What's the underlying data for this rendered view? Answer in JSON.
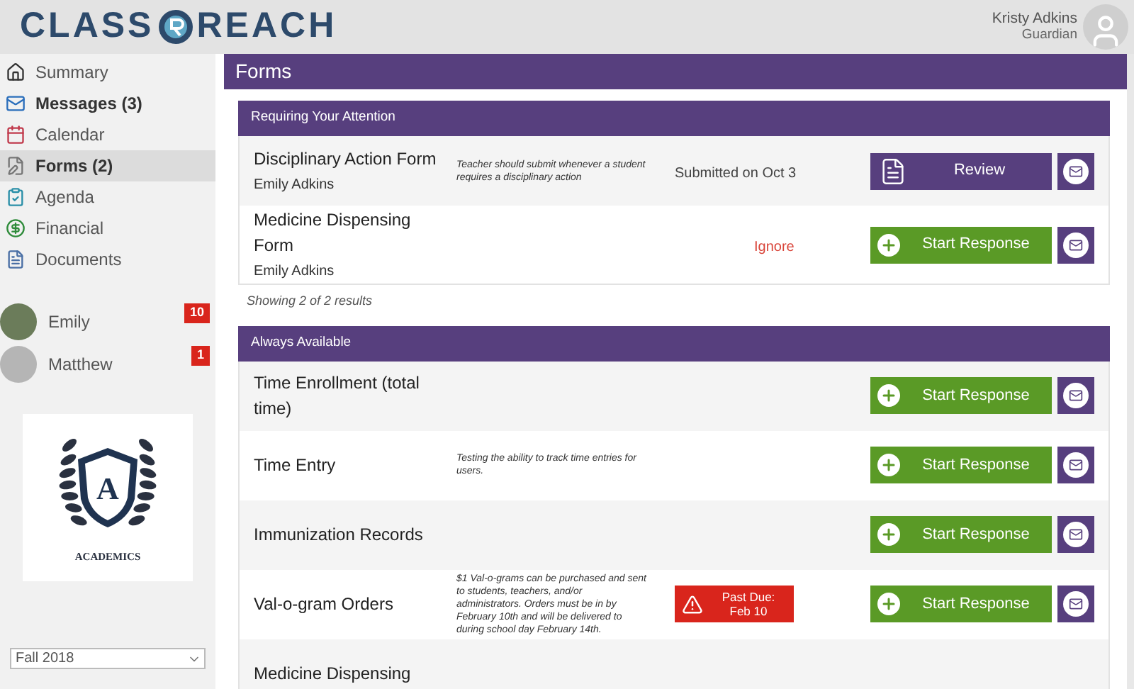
{
  "logo": {
    "left": "CLASS",
    "right": "REACH"
  },
  "user": {
    "name": "Kristy Adkins",
    "role": "Guardian"
  },
  "sidebar": {
    "items": [
      {
        "kind": "home",
        "label": "Summary",
        "bold": false,
        "selected": false
      },
      {
        "kind": "mail",
        "label": "Messages (3)",
        "bold": true,
        "selected": false
      },
      {
        "kind": "calendar",
        "label": "Calendar",
        "bold": false,
        "selected": false
      },
      {
        "kind": "forms",
        "label": "Forms (2)",
        "bold": true,
        "selected": true
      },
      {
        "kind": "agenda",
        "label": "Agenda",
        "bold": false,
        "selected": false
      },
      {
        "kind": "financial",
        "label": "Financial",
        "bold": false,
        "selected": false
      },
      {
        "kind": "documents",
        "label": "Documents",
        "bold": false,
        "selected": false
      }
    ],
    "students": [
      {
        "name": "Emily",
        "badge": "10",
        "photo": true
      },
      {
        "name": "Matthew",
        "badge": "1",
        "photo": false
      }
    ],
    "school_logo": {
      "letter": "A",
      "caption": "ACADEMICS"
    },
    "term_select": {
      "value": "Fall 2018"
    }
  },
  "page_title": "Forms",
  "sections": [
    {
      "title": "Requiring Your Attention",
      "footer": "Showing 2 of 2 results",
      "rows": [
        {
          "title": "Disciplinary Action Form",
          "subtitle": "Emily Adkins",
          "description": "Teacher should submit whenever a student requires a disciplinary action",
          "status": {
            "kind": "submitted",
            "text": "Submitted on Oct 3"
          },
          "action": {
            "kind": "review",
            "label": "Review"
          }
        },
        {
          "title": "Medicine Dispensing Form",
          "subtitle": "Emily Adkins",
          "status": {
            "kind": "ignore",
            "text": "Ignore"
          },
          "action": {
            "kind": "start",
            "label": "Start Response"
          }
        }
      ]
    },
    {
      "title": "Always Available",
      "rows": [
        {
          "title": "Time Enrollment (total time)",
          "action": {
            "kind": "start",
            "label": "Start Response"
          }
        },
        {
          "title": "Time Entry",
          "description": "Testing the ability to track time entries for users.",
          "action": {
            "kind": "start",
            "label": "Start Response"
          }
        },
        {
          "title": "Immunization Records",
          "action": {
            "kind": "start",
            "label": "Start Response"
          }
        },
        {
          "title": "Val-o-gram Orders",
          "description": "$1 Val-o-grams can be purchased and sent to students, teachers, and/or administrators. Orders must be in by February 10th and will be delivered to during school day February 14th.",
          "status": {
            "kind": "past_due",
            "text": "Past Due: Feb 10"
          },
          "action": {
            "kind": "start",
            "label": "Start Response"
          }
        },
        {
          "title": "Medicine Dispensing"
        }
      ]
    }
  ]
}
